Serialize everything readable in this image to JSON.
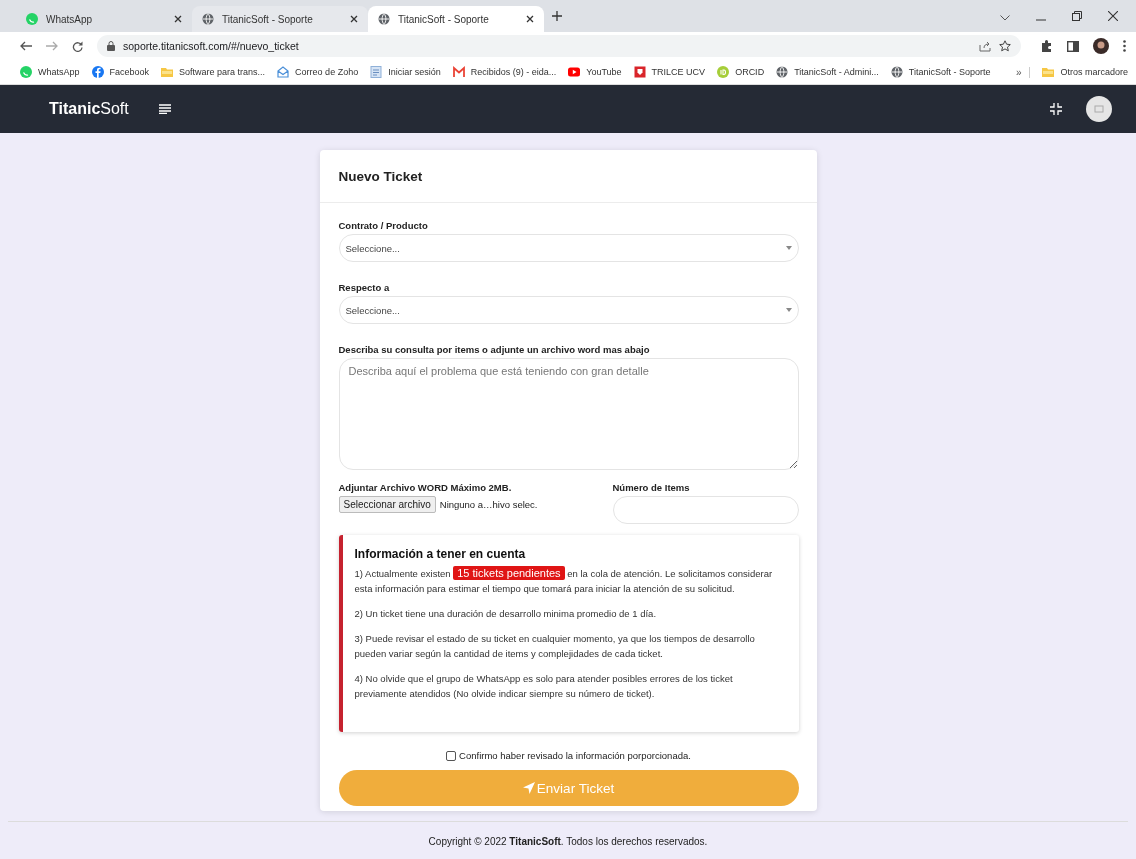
{
  "browser": {
    "tabs": [
      {
        "title": "WhatsApp",
        "selected": false
      },
      {
        "title": "TitanicSoft - Soporte",
        "selected": false
      },
      {
        "title": "TitanicSoft - Soporte",
        "selected": true
      }
    ],
    "address": "soporte.titanicsoft.com/#/nuevo_ticket",
    "bookmarks": [
      {
        "label": "WhatsApp"
      },
      {
        "label": "Facebook"
      },
      {
        "label": "Software para trans..."
      },
      {
        "label": "Correo de Zoho"
      },
      {
        "label": "Iniciar sesión"
      },
      {
        "label": "Recibidos (9) - eida..."
      },
      {
        "label": "YouTube"
      },
      {
        "label": "TRILCE UCV"
      },
      {
        "label": "ORCID"
      },
      {
        "label": "TitanicSoft - Admini..."
      },
      {
        "label": "TitanicSoft - Soporte"
      }
    ],
    "overflow": "»",
    "other_bookmarks": "Otros marcadore"
  },
  "navbar": {
    "brand": "**Titanic**Soft"
  },
  "form": {
    "title": "Nuevo Ticket",
    "fields": [
      {
        "kind": "select",
        "label": "Contrato / Producto",
        "value": "Seleccione..."
      },
      {
        "kind": "select",
        "label": "Respecto a",
        "value": "Seleccione..."
      },
      {
        "kind": "textarea",
        "label": "Describa su consulta por items o adjunte un archivo word mas abajo",
        "placeholder": "Describa aquí el problema que está teniendo con gran detalle"
      }
    ],
    "attachment": {
      "label": "Adjuntar Archivo WORD Máximo 2MB.",
      "button": "Seleccionar archivo",
      "status": "Ninguno a…hivo selec."
    },
    "items_count": {
      "label": "Número de Items"
    },
    "info": {
      "title": "Información a tener en cuenta",
      "items": [
        {
          "before": "1) Actualmente existen",
          "badge": "15 tickets pendientes",
          "after": "en la cola de atención. Le solicitamos considerar",
          "continued": "esta información para estimar el tiempo que tomará para iniciar la atención de su solicitud."
        },
        {
          "before": "2) Un ticket tiene una duración de desarrollo minima promedio de 1 día."
        },
        {
          "before": "3) Puede revisar el estado de su ticket en cualquier momento, ya que los tiempos de desarrollo pueden variar según la cantidad de items y complejidades de cada ticket."
        },
        {
          "before": "4) No olvide que el grupo de WhatsApp es solo para atender posibles errores de los ticket previamente atendidos (No olvide indicar siempre su número de ticket)."
        }
      ]
    },
    "confirm": {
      "label": "Confirmo haber revisado la información porporcionada.",
      "checked": false
    },
    "submit": "Enviar Ticket"
  },
  "footer": "Copyright © 2022 **TitanicSoft**. Todos los derechos reservados."
}
